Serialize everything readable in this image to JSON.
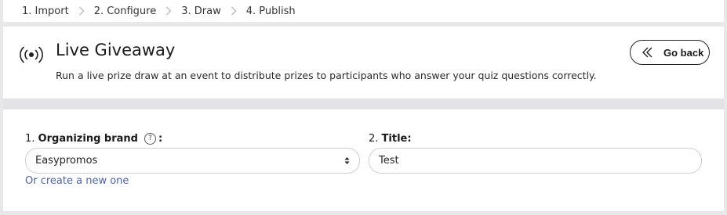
{
  "stepper": {
    "steps": [
      "1. Import",
      "2. Configure",
      "3. Draw",
      "4. Publish"
    ]
  },
  "header": {
    "icon": "broadcast-icon",
    "title": "Live Giveaway",
    "description": "Run a live prize draw at an event to distribute prizes to participants who answer your quiz questions correctly.",
    "go_back_icon": "double-chevron-left-icon",
    "go_back_label": "Go back"
  },
  "form": {
    "brand": {
      "number": "1.",
      "label": "Organizing brand",
      "suffix": ":",
      "help_icon": "question-circle-icon",
      "selected_value": "Easypromos",
      "create_link": "Or create a new one"
    },
    "title": {
      "number": "2.",
      "label": "Title:",
      "value": "Test"
    }
  },
  "colors": {
    "background": "#e8e8ea",
    "link": "#4a62b8",
    "input_border": "#cfcfd3"
  }
}
